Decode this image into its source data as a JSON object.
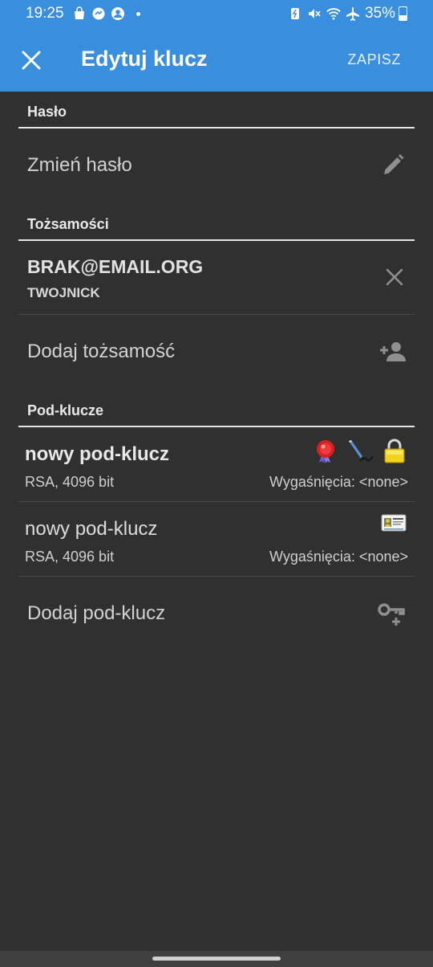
{
  "status_bar": {
    "time": "19:25",
    "battery": "35%",
    "battery_level": 0.35,
    "left_icons": [
      "shopping-bag-icon",
      "messenger-icon",
      "account-icon",
      "notification-dot"
    ],
    "right_icons": [
      "battery-saver-icon",
      "mute-icon",
      "wifi-icon",
      "airplane-icon",
      "battery-icon"
    ]
  },
  "app_bar": {
    "title": "Edytuj klucz",
    "save_label": "ZAPISZ",
    "close_icon": "close-icon"
  },
  "sections": {
    "password": {
      "header": "Hasło",
      "change_label": "Zmień hasło",
      "icon": "pencil-icon"
    },
    "identities": {
      "header": "Tożsamości",
      "items": [
        {
          "email": "BRAK@EMAIL.ORG",
          "name": "TWOJNICK"
        }
      ],
      "add_label": "Dodaj tożsamość",
      "add_icon": "add-person-icon"
    },
    "subkeys": {
      "header": "Pod-klucze",
      "items": [
        {
          "name": "nowy pod-klucz",
          "bold": true,
          "algo": "RSA, 4096 bit",
          "expiry": "Wygaśnięcia: <none>",
          "icons": [
            "certify-seal-icon",
            "sign-pen-icon",
            "encrypt-lock-icon"
          ]
        },
        {
          "name": "nowy pod-klucz",
          "bold": false,
          "algo": "RSA, 4096 bit",
          "expiry": "Wygaśnięcia: <none>",
          "icons": [
            "authenticate-id-card-icon"
          ]
        }
      ],
      "add_label": "Dodaj pod-klucz",
      "add_icon": "add-key-icon"
    }
  },
  "colors": {
    "app_bar": "#3a8ede",
    "background": "#303030",
    "divider": "#e5e5e5"
  }
}
